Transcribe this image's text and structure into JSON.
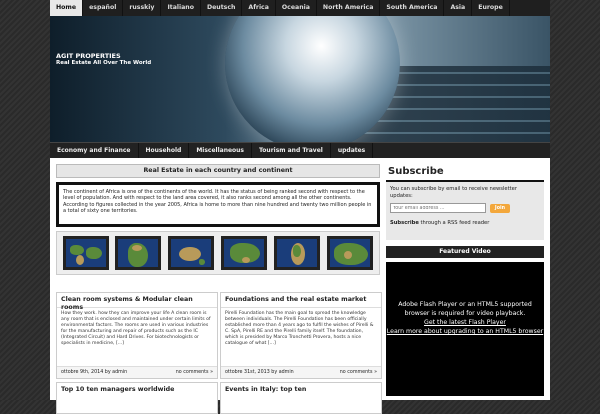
{
  "top_nav": {
    "tabs": [
      {
        "label": "Home",
        "active": true
      },
      {
        "label": "español"
      },
      {
        "label": "russkiy"
      },
      {
        "label": "Italiano"
      },
      {
        "label": "Deutsch"
      },
      {
        "label": "Africa"
      },
      {
        "label": "Oceania"
      },
      {
        "label": "North America"
      },
      {
        "label": "South America"
      },
      {
        "label": "Asia"
      },
      {
        "label": "Europe"
      }
    ]
  },
  "header": {
    "site_title": "AGIT PROPERTIES",
    "tagline": "Real Estate All Over The World"
  },
  "cat_nav": {
    "tabs": [
      {
        "label": "Economy and Finance"
      },
      {
        "label": "Household"
      },
      {
        "label": "Miscellaneous"
      },
      {
        "label": "Tourism and Travel"
      },
      {
        "label": "updates"
      }
    ]
  },
  "main": {
    "section_title": "Real Estate in each country and continent",
    "intro_text": "The continent of Africa is one of the continents of the world. It has the status of being ranked second with respect to the level of population. And with respect to the land area covered, it also ranks second among all the other continents. According to figures collected in the year 2005, Africa is home to more than nine hundred and twenty two million people in a total of sixty one territories.",
    "posts": [
      {
        "title": "Clean room systems & Modular clean rooms",
        "body": "How they work. how they can improve your life A clean room is any room that is enclosed and maintained under certain limits of environmental factors. The rooms are used in various industries for the manufacturing and repair of products such as the IC (Integrated Circuit) and Hard Drives. For biotechnologists or specialists in medicine, [...]",
        "date": "ottobre 9th, 2014 by admin",
        "comments": "no comments »"
      },
      {
        "title": "Foundations and the real estate market",
        "body": "Pirelli Foundation has the main goal to spread the knowledge between individuals. The Pirelli Foundation has been officially established more than 4 years ago to fulfil the wishes of Pirelli & C. SpA, Pirelli RE and the Pirelli family itself. The foundation, which is presided by Marco Tronchetti Provera, hosts a nice catalogue of what [...]",
        "date": "ottobre 31st, 2013 by admin",
        "comments": "no comments »"
      }
    ],
    "more_posts": [
      {
        "title": "Top 10 ten managers worldwide"
      },
      {
        "title": "Events in Italy: top ten"
      }
    ]
  },
  "sidebar": {
    "subscribe_title": "Subscribe",
    "subscribe_text": "You can subscribe by email to receive newsletter updates:",
    "email_placeholder": "Your email address ...",
    "join_label": "Join",
    "rss_bold": "Subscribe",
    "rss_text": " through a RSS feed reader",
    "featured_title": "Featured Video",
    "video_msg": "Adobe Flash Player or an HTML5 supported browser is required for video playback.",
    "video_link1": "Get the latest Flash Player",
    "video_link2": "Learn more about upgrading to an HTML5 browser"
  }
}
